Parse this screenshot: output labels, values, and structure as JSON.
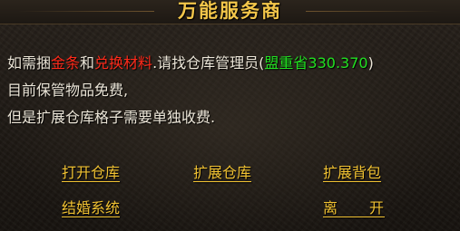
{
  "dialog": {
    "title": "万能服务商"
  },
  "message": {
    "line1": {
      "prefix": "如需捆",
      "gold": "金条",
      "and": "和",
      "exchange": "兑换材料",
      "mid": ".请找仓库管理员(",
      "location": "盟重省330.370",
      "suffix": ")"
    },
    "line2": "目前保管物品免费,",
    "line3": "但是扩展仓库格子需要单独收费."
  },
  "options": {
    "open_storage": "打开仓库",
    "expand_storage": "扩展仓库",
    "expand_bag": "扩展背包",
    "marriage": "结婚系统",
    "leave": "离　　开"
  },
  "colors": {
    "title": "#f3c64a",
    "highlight_red": "#ff2a1a",
    "highlight_green": "#21e021",
    "option": "#f1c232",
    "text": "#ece6d8"
  }
}
